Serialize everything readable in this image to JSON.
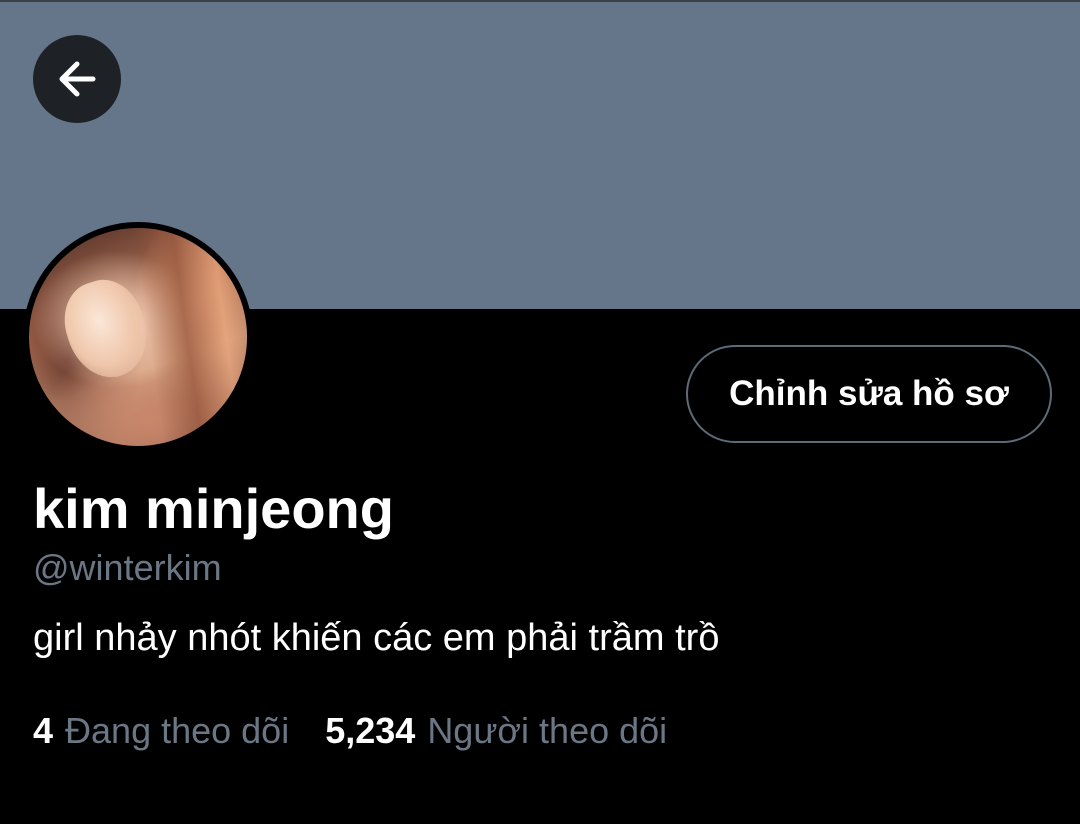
{
  "header": {
    "back_icon": "arrow-left-icon",
    "banner_color": "#66768a"
  },
  "profile": {
    "avatar_icon": "profile-photo",
    "edit_button_label": "Chỉnh sửa hồ sơ",
    "display_name": "kim minjeong",
    "handle": "@winterkim",
    "bio": "girl nhảy nhót khiến các em phải trầm trồ"
  },
  "stats": {
    "following_count": "4",
    "following_label": "Đang theo dõi",
    "followers_count": "5,234",
    "followers_label": "Người theo dõi"
  },
  "colors": {
    "background": "#000000",
    "primary_text": "#ffffff",
    "secondary_text": "#6b7785",
    "button_border": "#5d6a78"
  }
}
